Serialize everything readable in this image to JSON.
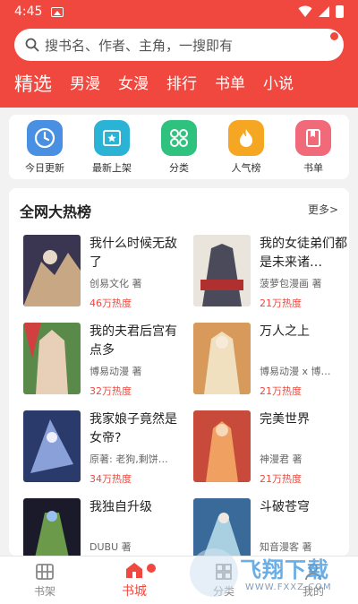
{
  "status": {
    "time": "4:45"
  },
  "search": {
    "placeholder": "搜书名、作者、主角，一搜即有"
  },
  "tabs": [
    "精选",
    "男漫",
    "女漫",
    "排行",
    "书单",
    "小说"
  ],
  "categories": [
    {
      "label": "今日更新",
      "icon": "clock-icon",
      "color": "#4a90e2"
    },
    {
      "label": "最新上架",
      "icon": "star-shelf-icon",
      "color": "#2bb3d6"
    },
    {
      "label": "分类",
      "icon": "grid-icon",
      "color": "#2ec27e"
    },
    {
      "label": "人气榜",
      "icon": "fire-icon",
      "color": "#f5a623"
    },
    {
      "label": "书单",
      "icon": "book-icon",
      "color": "#f06a7a"
    }
  ],
  "ranking": {
    "title": "全网大热榜",
    "more": "更多>",
    "books": [
      {
        "title": "我什么时候无敌了",
        "author": "创易文化 著",
        "heat": "46万热度",
        "cover_colors": [
          "#3a3550",
          "#c8a884"
        ]
      },
      {
        "title": "我的女徒弟们都是未来诸…",
        "author": "菠萝包漫画 著",
        "heat": "21万热度",
        "cover_colors": [
          "#e9e4dc",
          "#4a4a5a"
        ]
      },
      {
        "title": "我的夫君后宫有点多",
        "author": "博易动漫 著",
        "heat": "32万热度",
        "cover_colors": [
          "#5a8a4a",
          "#e8d0b8"
        ]
      },
      {
        "title": "万人之上",
        "author": "博易动漫 x 博…",
        "heat": "21万热度",
        "cover_colors": [
          "#d89a5a",
          "#f0e0c0"
        ]
      },
      {
        "title": "我家娘子竟然是女帝?",
        "author": "原著: 老狗,剩饼…",
        "heat": "34万热度",
        "cover_colors": [
          "#2a3a6a",
          "#8aa0d8"
        ]
      },
      {
        "title": "完美世界",
        "author": "神漫君 著",
        "heat": "21万热度",
        "cover_colors": [
          "#c84a3a",
          "#f0a060"
        ]
      },
      {
        "title": "我独自升级",
        "author": "DUBU 著",
        "heat": "",
        "cover_colors": [
          "#1a1a2a",
          "#6a9a4a"
        ]
      },
      {
        "title": "斗破苍穹",
        "author": "知音漫客 著",
        "heat": "",
        "cover_colors": [
          "#3a6a9a",
          "#a8d0e0"
        ]
      }
    ]
  },
  "bottom_nav": [
    {
      "label": "书架",
      "icon": "bookshelf-icon"
    },
    {
      "label": "书城",
      "icon": "store-icon"
    },
    {
      "label": "分类",
      "icon": "category-icon"
    },
    {
      "label": "我的",
      "icon": "profile-icon"
    }
  ],
  "watermark": {
    "text": "飞翔下载",
    "url": "WWW.FXXZ.COM"
  },
  "colors": {
    "brand": "#f0483e",
    "heat": "#f0483e"
  }
}
